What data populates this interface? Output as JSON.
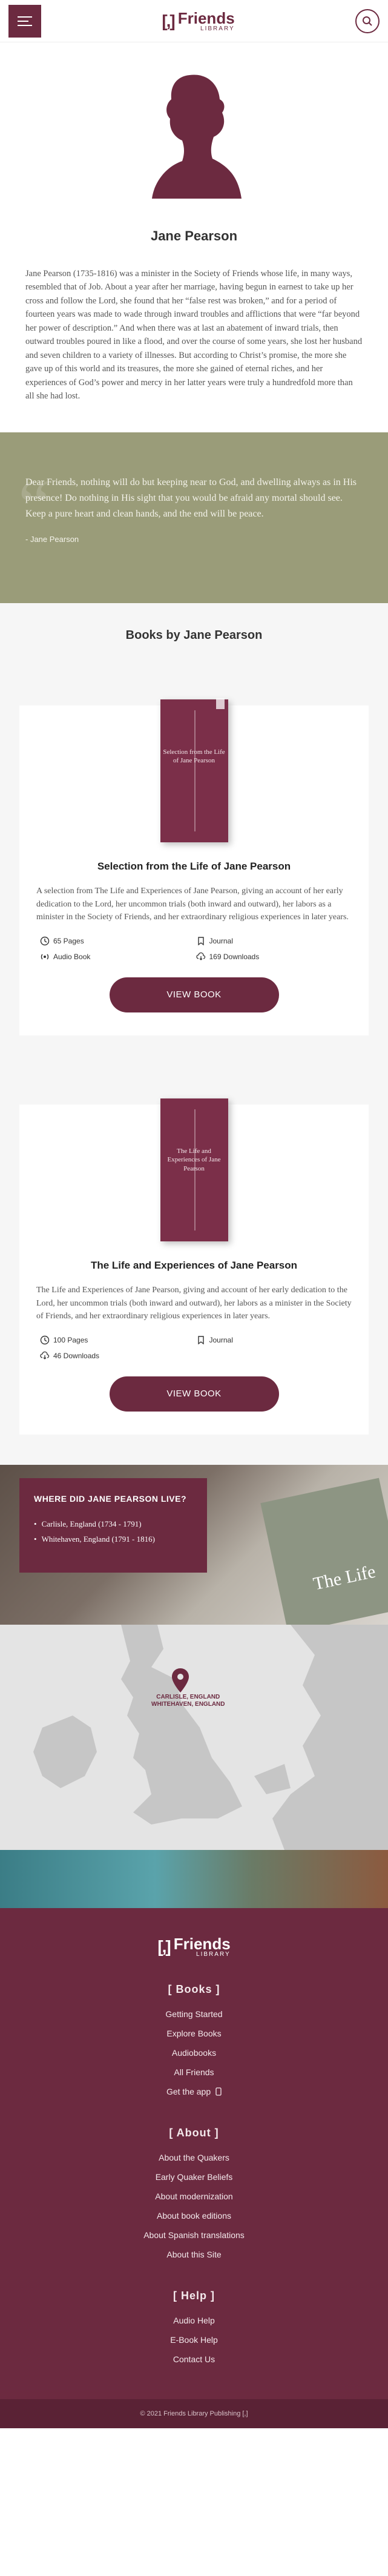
{
  "header": {
    "logo_mark": "[,]",
    "logo_name": "Friends",
    "logo_sub": "LIBRARY"
  },
  "author": {
    "name": "Jane Pearson",
    "bio": "Jane Pearson (1735-1816) was a minister in the Society of Friends whose life, in many ways, resembled that of Job. About a year after her marriage, having begun in earnest to take up her cross and follow the Lord, she found that her “false rest was broken,” and for a period of fourteen years was made to wade through inward troubles and afflictions that were “far beyond her power of description.” And when there was at last an abatement of inward trials, then outward troubles poured in like a flood, and over the course of some years, she lost her husband and seven children to a variety of illnesses. But according to Christ’s promise, the more she gave up of this world and its treasures, the more she gained of eternal riches, and her experiences of God’s power and mercy in her latter years were truly a hundredfold more than all she had lost."
  },
  "quote": {
    "text": "Dear Friends, nothing will do but keeping near to God, and dwelling always as in His presence! Do nothing in His sight that you would be afraid any mortal should see. Keep a pure heart and clean hands, and the end will be peace.",
    "cite": "- Jane Pearson"
  },
  "books_section": {
    "title": "Books by Jane Pearson"
  },
  "books": [
    {
      "cover_title": "Selection from the Life of Jane Pearson",
      "name": "Selection from the Life of Jane Pearson",
      "description": "A selection from The Life and Experiences of Jane Pearson, giving an account of her early dedication to the Lord, her uncommon trials (both inward and outward), her labors as a minister in the Society of Friends, and her extraordinary religious experiences in later years.",
      "pages": "65 Pages",
      "type": "Journal",
      "audio": "Audio Book",
      "downloads": "169 Downloads",
      "button": "VIEW BOOK"
    },
    {
      "cover_title": "The Life and Experiences of Jane Pearson",
      "name": "The Life and Experiences of Jane Pearson",
      "description": "The Life and Experiences of Jane Pearson, giving and account of her early dedication to the Lord, her uncommon trials (both inward and outward), her labors as a minister in the Society of Friends, and her extraordinary religious experiences in later years.",
      "pages": "100 Pages",
      "type": "Journal",
      "downloads": "46 Downloads",
      "button": "VIEW BOOK"
    }
  ],
  "where": {
    "title": "WHERE DID JANE PEARSON LIVE?",
    "places": [
      "Carlisle, England (1734 - 1791)",
      "Whitehaven, England (1791 - 1816)"
    ],
    "book_fragment": "The Life"
  },
  "map": {
    "label_1": "CARLISLE, ENGLAND",
    "label_2": "WHITEHAVEN, ENGLAND"
  },
  "footer": {
    "logo_mark": "[,]",
    "logo_name": "Friends",
    "logo_sub": "LIBRARY",
    "books_heading": "[ Books ]",
    "books_links": [
      "Getting Started",
      "Explore Books",
      "Audiobooks",
      "All Friends",
      "Get the app"
    ],
    "about_heading": "[ About ]",
    "about_links": [
      "About the Quakers",
      "Early Quaker Beliefs",
      "About modernization",
      "About book editions",
      "About Spanish translations",
      "About this Site"
    ],
    "help_heading": "[ Help ]",
    "help_links": [
      "Audio Help",
      "E-Book Help",
      "Contact Us"
    ],
    "copyright": "© 2021 Friends Library Publishing [,]"
  },
  "colors": {
    "brand": "#6c2a40",
    "quote_band": "#9a9c79",
    "map_bg": "#e4e4e4"
  }
}
